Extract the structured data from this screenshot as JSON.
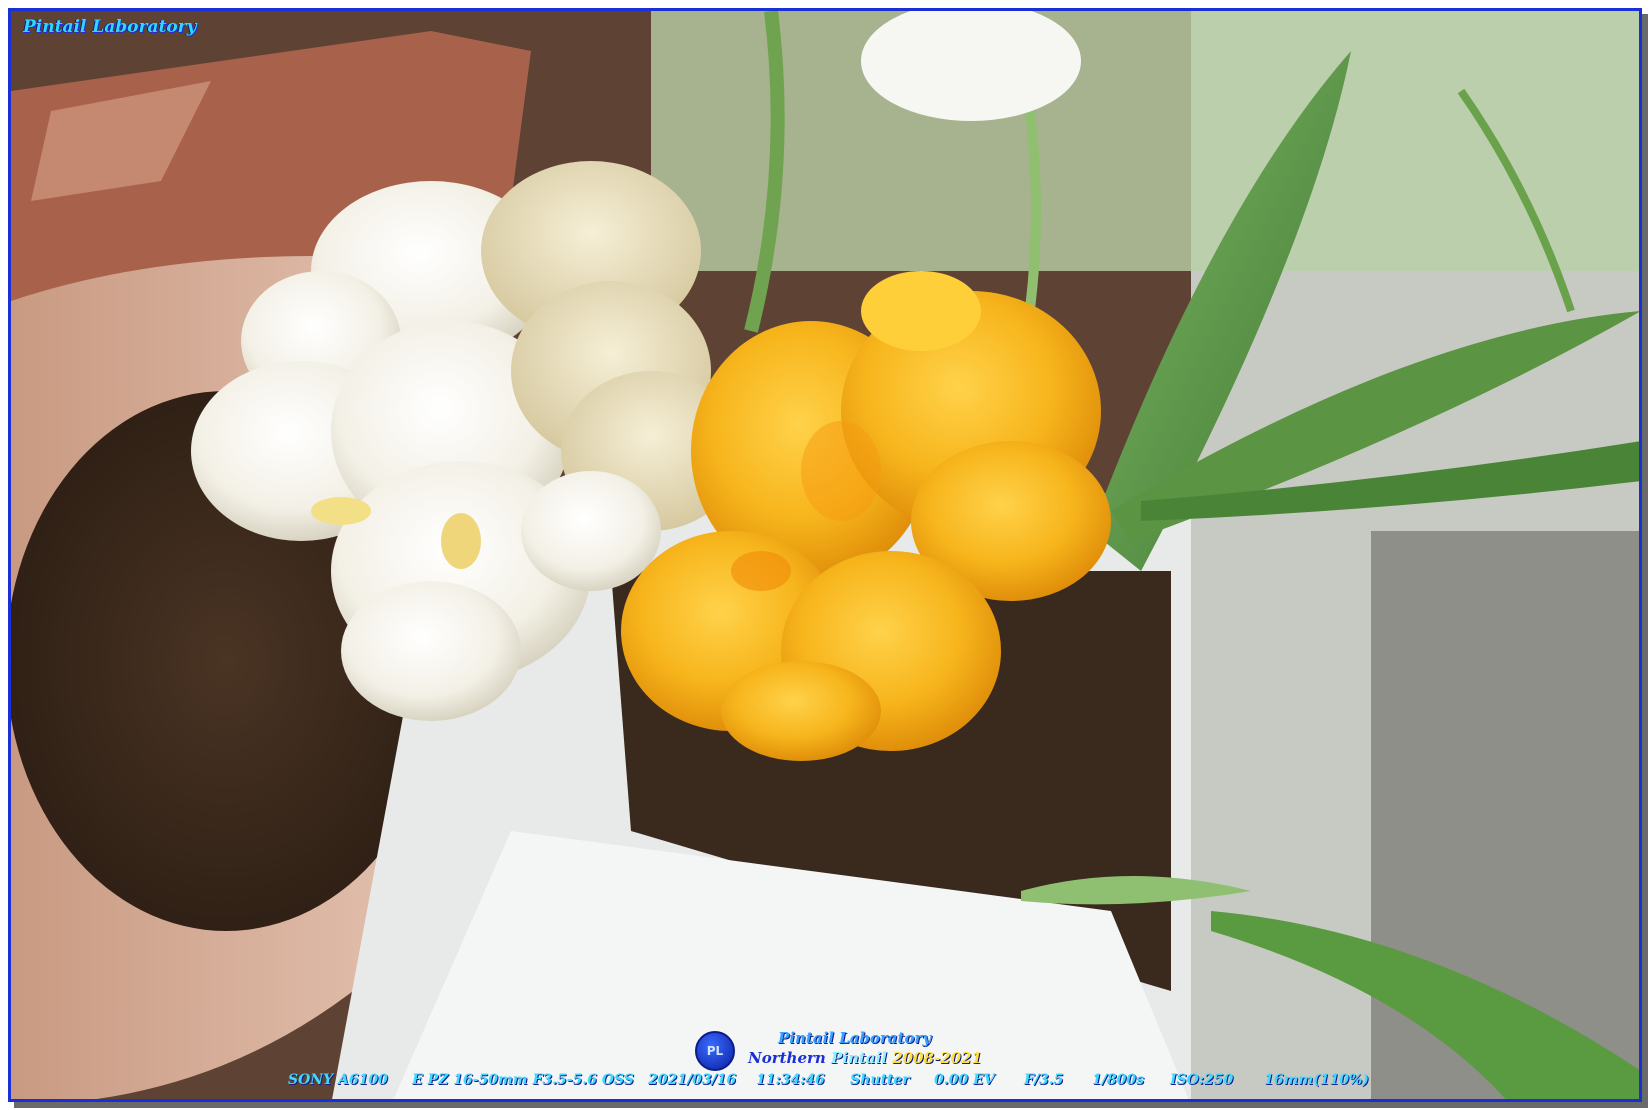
{
  "watermark": {
    "top_left": "Pintail Laboratory",
    "logo_text": "PL",
    "title": "Pintail Laboratory",
    "credit_prefix": "Northern ",
    "credit_name": "Pintail",
    "credit_years": " 2008-2021"
  },
  "exif": {
    "camera": "SONY A6100",
    "lens": "E PZ 16-50mm F3.5-5.6 OSS",
    "date": "2021/03/16",
    "time": "11:34:46",
    "mode": "Shutter",
    "exposure_comp": "0.00 EV",
    "aperture": "F/3.5",
    "shutter": "1/800s",
    "iso": "ISO:250",
    "focal": "16mm(110%)"
  },
  "colors": {
    "border": "#1a2fd6",
    "accent_text": "#40d8ff",
    "white_flower": "#f7f4ec",
    "yellow_flower": "#f7b51c",
    "leaf": "#4f8a3a"
  }
}
